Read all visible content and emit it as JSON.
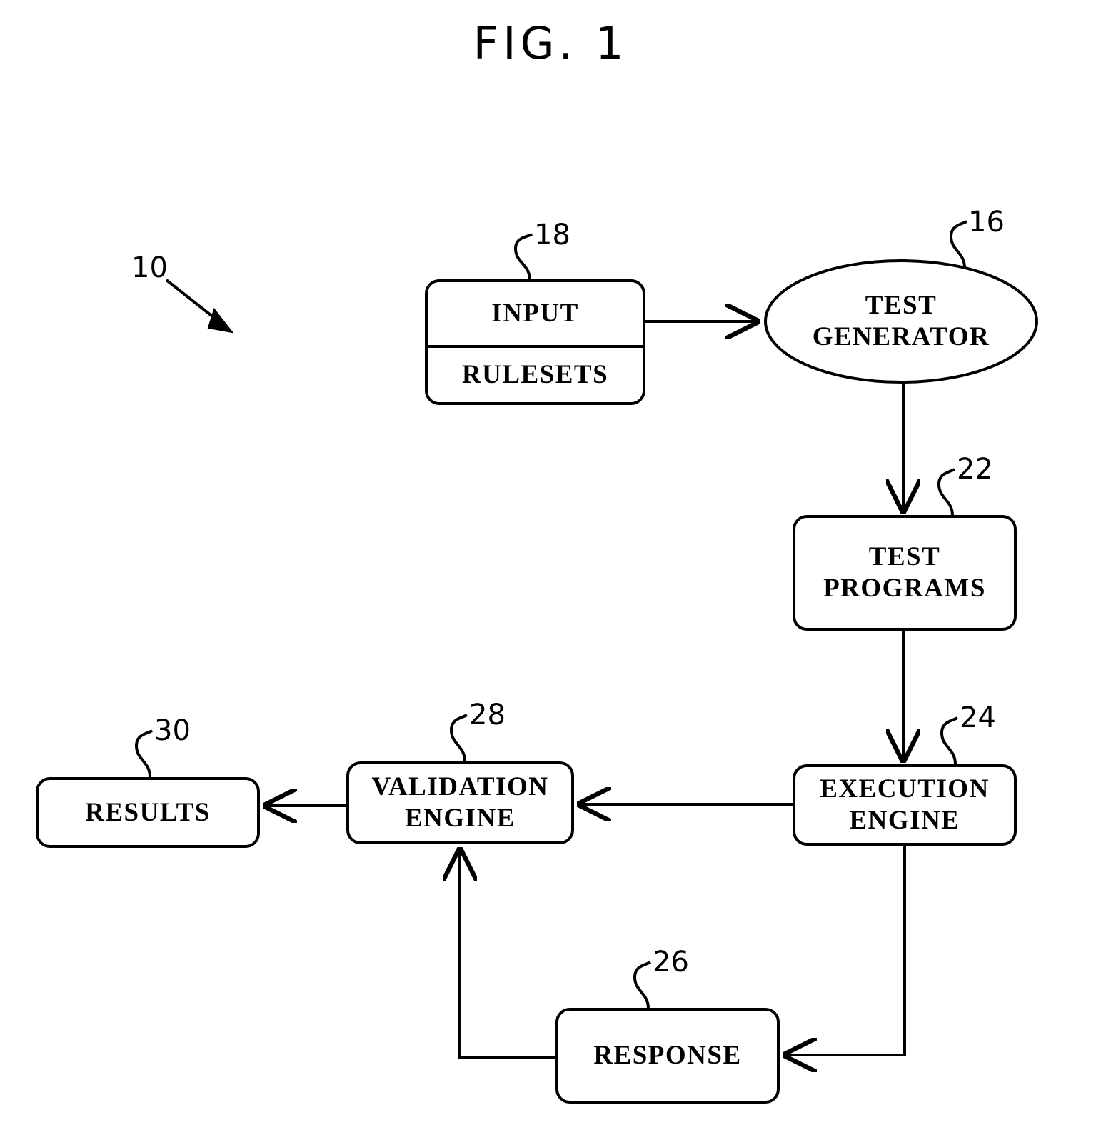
{
  "figure": {
    "title": "FIG.  1",
    "overall_ref": "10"
  },
  "diagram": {
    "type": "flowchart",
    "nodes": [
      {
        "id": "input",
        "ref": "18",
        "lines": [
          "INPUT",
          "RULESETS"
        ],
        "shape": "rounded-rect-split"
      },
      {
        "id": "test_generator",
        "ref": "16",
        "lines": [
          "TEST",
          "GENERATOR"
        ],
        "shape": "ellipse"
      },
      {
        "id": "test_programs",
        "ref": "22",
        "lines": [
          "TEST",
          "PROGRAMS"
        ],
        "shape": "rounded-rect"
      },
      {
        "id": "execution_engine",
        "ref": "24",
        "lines": [
          "EXECUTION",
          "ENGINE"
        ],
        "shape": "rounded-rect"
      },
      {
        "id": "response",
        "ref": "26",
        "lines": [
          "RESPONSE"
        ],
        "shape": "rounded-rect"
      },
      {
        "id": "validation_engine",
        "ref": "28",
        "lines": [
          "VALIDATION",
          "ENGINE"
        ],
        "shape": "rounded-rect"
      },
      {
        "id": "results",
        "ref": "30",
        "lines": [
          "RESULTS"
        ],
        "shape": "rounded-rect"
      }
    ],
    "edges": [
      {
        "from": "input",
        "to": "test_generator"
      },
      {
        "from": "test_generator",
        "to": "test_programs"
      },
      {
        "from": "test_programs",
        "to": "execution_engine"
      },
      {
        "from": "execution_engine",
        "to": "validation_engine"
      },
      {
        "from": "execution_engine",
        "to": "response"
      },
      {
        "from": "response",
        "to": "validation_engine"
      },
      {
        "from": "validation_engine",
        "to": "results"
      }
    ]
  },
  "labels": {
    "input_1": "INPUT",
    "input_2": "RULESETS",
    "test_generator_1": "TEST",
    "test_generator_2": "GENERATOR",
    "test_programs_1": "TEST",
    "test_programs_2": "PROGRAMS",
    "execution_engine_1": "EXECUTION",
    "execution_engine_2": "ENGINE",
    "response_1": "RESPONSE",
    "validation_engine_1": "VALIDATION",
    "validation_engine_2": "ENGINE",
    "results_1": "RESULTS"
  },
  "refs": {
    "r10": "10",
    "r16": "16",
    "r18": "18",
    "r22": "22",
    "r24": "24",
    "r26": "26",
    "r28": "28",
    "r30": "30"
  },
  "style": {
    "stroke": "#000000",
    "background": "#ffffff"
  }
}
